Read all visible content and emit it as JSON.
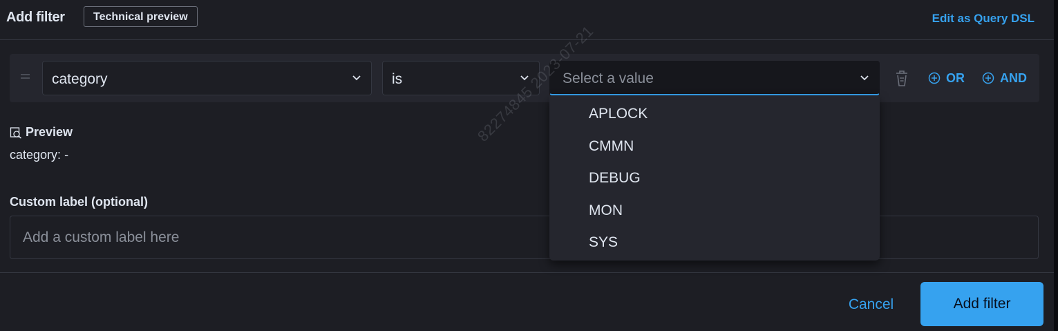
{
  "header": {
    "title": "Add filter",
    "badge": "Technical preview",
    "edit_dsl_link": "Edit as Query DSL"
  },
  "filter_row": {
    "field": {
      "value": "category"
    },
    "operator": {
      "value": "is"
    },
    "value": {
      "placeholder": "Select a value"
    },
    "or_label": "OR",
    "and_label": "AND"
  },
  "value_dropdown": {
    "options": [
      "APLOCK",
      "CMMN",
      "DEBUG",
      "MON",
      "SYS"
    ]
  },
  "preview": {
    "title": "Preview",
    "field": "category:",
    "value": "-"
  },
  "custom_label": {
    "title": "Custom label (optional)",
    "placeholder": "Add a custom label here"
  },
  "footer": {
    "cancel_label": "Cancel",
    "add_label": "Add filter"
  },
  "watermark": {
    "text": "82274845  2023-07-21"
  },
  "colors": {
    "background": "#1d1e24",
    "panel": "#25262e",
    "accent": "#36a2ef",
    "text": "#dfe5ef",
    "muted": "#8a8f99",
    "border": "#343741"
  },
  "icons": {
    "drag": "drag-handle-icon",
    "chevron": "chevron-down-icon",
    "trash": "trash-icon",
    "plus": "plus-circle-icon",
    "preview": "inspect-icon"
  }
}
